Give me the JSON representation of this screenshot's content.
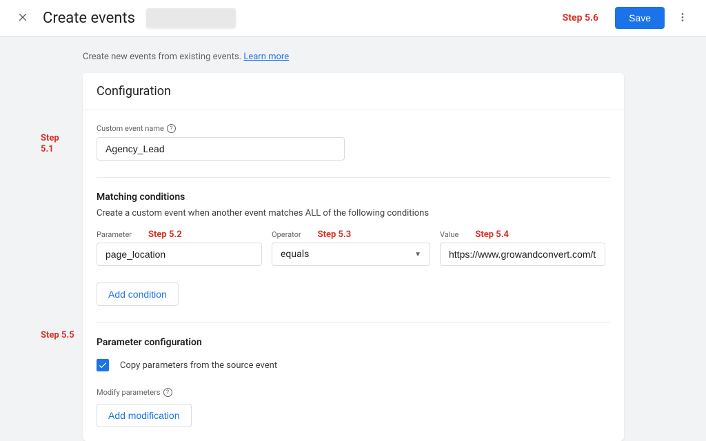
{
  "header": {
    "title": "Create events",
    "step_badge": "Step 5.6",
    "save": "Save"
  },
  "intro": {
    "text": "Create new events from existing events. ",
    "link": "Learn more"
  },
  "config": {
    "title": "Configuration",
    "event_name_label": "Custom event name",
    "event_name_value": "Agency_Lead",
    "matching_title": "Matching conditions",
    "matching_sub": "Create a custom event when another event matches ALL of the following conditions",
    "parameter_label": "Parameter",
    "parameter_value": "page_location",
    "operator_label": "Operator",
    "operator_value": "equals",
    "value_label": "Value",
    "value_value": "https://www.growandconvert.com/thank-",
    "add_condition": "Add condition",
    "param_config_title": "Parameter configuration",
    "copy_params_label": "Copy parameters from the source event",
    "modify_params_label": "Modify parameters",
    "add_modification": "Add modification"
  },
  "annotations": {
    "step51": "Step 5.1",
    "step52": "Step 5.2",
    "step53": "Step 5.3",
    "step54": "Step 5.4",
    "step55": "Step 5.5"
  }
}
